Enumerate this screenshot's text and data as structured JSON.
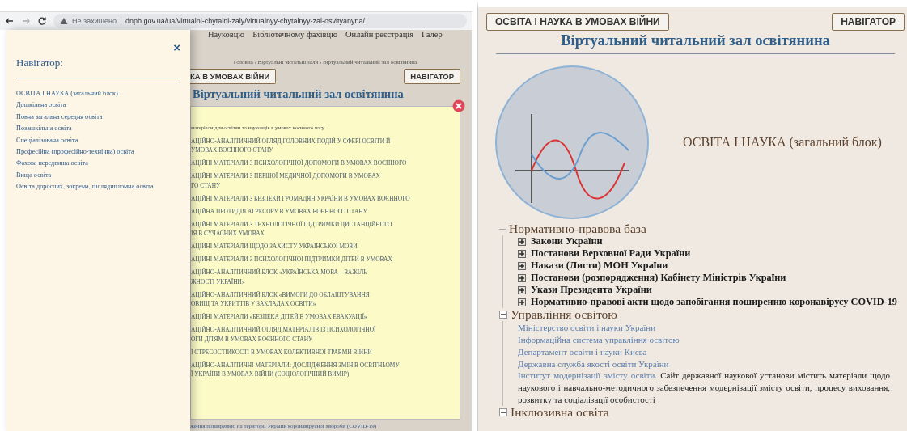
{
  "left_screenshot": {
    "browser": {
      "security_label": "Не захищено",
      "url": "dnpb.gov.ua/ua/virtualni-chytalni-zaly/virtualnyy-chytalnyy-zal-osvityanyna/"
    },
    "navigator_drawer": {
      "title": "Навігатор:",
      "close": "×",
      "items": [
        "ОСВІТА І НАУКА (загальний блок)",
        "Дошкільна освіта",
        "Повна загальна середня освіта",
        "Позашкільна освіта",
        "Спеціалізована освіта",
        "Професійна (професійно-технічна) освіта",
        "Фахова передвища освіта",
        "Вища освіта",
        "Освіта дорослих, зокрема, післядипломна освіта"
      ]
    },
    "page": {
      "top_menu": [
        "Науковцю",
        "Бібліотечному фахівцю",
        "Онлайн реєстрація",
        "Галер"
      ],
      "breadcrumb": "Головна › Віртуальні читальні зали › Віртуальний читальний зал освітянина",
      "buttons": [
        "КА В УМОВАХ ВІЙНИ",
        "НАВІГАТОР"
      ],
      "title": "Віртуальний читальний зал освітянина",
      "popup": {
        "intro": "матеріали для освітян та науковців в умовах воєнного часу",
        "items": [
          {
            "lines": [
              "АЦІЙНО-АНАЛІТИЧНИЙ ОГЛЯД ГОЛОВНИХ ПОДІЙ У СФЕРІ ОСВІТИ Й",
              "УМОВАХ ВОЄННОГО СТАНУ"
            ]
          },
          {
            "lines": [
              "АЦІЙНІ МАТЕРІАЛИ З ПСИХОЛОГІЧНОЇ ДОПОМОГИ В УМОВАХ ВОЄННОГО"
            ]
          },
          {
            "lines": [
              "АЦІЙНІ МАТЕРІАЛИ З ПЕРШОЇ МЕДИЧНОЇ ДОПОМОГИ В УМОВАХ",
              "ГО СТАНУ"
            ]
          },
          {
            "lines": [
              "АЦІЙНІ МАТЕРІАЛИ З БЕЗПЕКИ ГРОМАДЯН УКРАЇНИ В УМОВАХ ВОЄННОГО"
            ]
          },
          {
            "lines": [
              "АЦІЙНА ПРОТИДІЯ АГРЕСОРУ В УМОВАХ ВОЄННОГО СТАНУ"
            ]
          },
          {
            "lines": [
              "АЦІЙНІ МАТЕРІАЛИ З ТЕХНОЛОГІЧНОЇ ПІДТРИМКИ ДИСТАНЦІЙНОГО",
              "ІЯ В СУЧАСНИХ УМОВАХ"
            ]
          },
          {
            "lines": [
              "АЦІЙНІ МАТЕРІАЛИ ЩОДО ЗАХИСТУ УКРАЇНСЬКОЇ МОВИ"
            ]
          },
          {
            "lines": [
              "АЦІЙНІ МАТЕРІАЛИ З ПСИХОЛОГІЧНОЇ ПІДТРИМКИ ДІТЕЙ В УМОВАХ"
            ]
          },
          {
            "lines": [
              "АЦІЙНО-АНАЛІТИЧНИЙ БЛОК «УКРАЇНСЬКА МОВА – ВАЖІЛЬ",
              "ЖНОСТІ УКРАЇНИ»"
            ]
          },
          {
            "lines": [
              "АЦІЙНО-АНАЛІТИЧНИЙ БЛОК «ВИМОГИ ДО ОБЛАШТУВАННЯ",
              "ОВИЩ ТА УКРИТТІВ У ЗАКЛАДАХ ОСВІТИ»"
            ]
          },
          {
            "lines": [
              "АЦІЙНІ МАТЕРІАЛИ «БЕЗПЕКА ДІТЕЙ В УМОВАХ ЕВАКУАЦІЇ»"
            ]
          },
          {
            "lines": [
              "АЦІЙНО-АНАЛІТИЧНИЙ ОГЛЯД МАТЕРІАЛІВ ІЗ ПСИХОЛОГІЧНОЇ",
              "ОГИ ДІТЯМ В УМОВАХ ВОЄННОГО СТАНУ"
            ]
          },
          {
            "lines": [
              "Ї СТРЕСОСТІЙКОСТІ В УМОВАХ КОЛЕКТИВНОЇ ТРАВМИ ВІЙНИ"
            ]
          },
          {
            "lines": [
              "АЦІЙНО-АНАЛІТИЧНІ МАТЕРІАЛИ: ДОСЛІДЖЕННЯ ЗМІН В ОСВІТНЬОМУ",
              "Ї УКРАЇНИ В УМОВАХ ВІЙНИ (СОЦІОЛОГІЧНИЙ ВИМІР)"
            ]
          }
        ]
      },
      "footer_text": "ження поширенню на території України коронавірусної хвороби (COVID-19)"
    }
  },
  "right_screenshot": {
    "buttons": [
      "ОСВІТА І НАУКА В УМОВАХ ВІЙНИ",
      "НАВІГАТОР"
    ],
    "title": "Віртуальний читальний зал освітянина",
    "section_heading": "ОСВІТА І НАУКА (загальний блок)",
    "tree": [
      {
        "label": "Нормативно-правова база",
        "kind": "plain",
        "children": [
          {
            "label": "Закони України",
            "kind": "toggle",
            "expanded": false
          },
          {
            "label": "Постанови Верховної Ради України",
            "kind": "toggle",
            "expanded": false
          },
          {
            "label": "Накази (Листи) МОН України",
            "kind": "toggle",
            "expanded": false
          },
          {
            "label": "Постанови (розпорядження) Кабінету Міністрів України",
            "kind": "toggle",
            "expanded": false
          },
          {
            "label": "Укази Президента України",
            "kind": "toggle",
            "expanded": false
          },
          {
            "label": "Нормативно-правові акти щодо запобігання поширенню коронавірусу COVID-19",
            "kind": "toggle",
            "expanded": false
          }
        ]
      },
      {
        "label": "Управління освітою",
        "kind": "toggle",
        "expanded": true,
        "children": [
          {
            "label": "Міністерство освіти і науки України",
            "kind": "link"
          },
          {
            "label": "Інформаційна система управління освітою",
            "kind": "link"
          },
          {
            "label": "Департамент освіти і науки Києва",
            "kind": "link"
          },
          {
            "label": "Державна служба якості освіти України",
            "kind": "link"
          },
          {
            "label": "Інститут модернізації змісту освіти.",
            "kind": "link",
            "description": "Сайт державної наукової установи містить матеріали щодо наукового і навчально-методичного забезпечення модернізації змісту освіти, процесу виховання, розвитку та соціалізації особистості"
          }
        ]
      },
      {
        "label": "Інклюзивна освіта",
        "kind": "toggle",
        "expanded": true
      }
    ]
  }
}
